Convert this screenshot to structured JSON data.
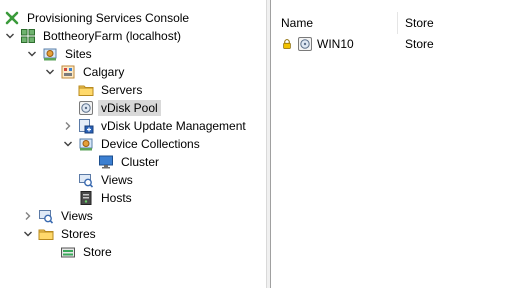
{
  "tree": {
    "root": "Provisioning Services Console",
    "farm": "BottheoryFarm (localhost)",
    "sites": "Sites",
    "site": "Calgary",
    "servers": "Servers",
    "vdisk_pool": "vDisk Pool",
    "vdisk_update": "vDisk Update Management",
    "device_collections": "Device Collections",
    "cluster": "Cluster",
    "site_views": "Views",
    "hosts": "Hosts",
    "views": "Views",
    "stores": "Stores",
    "store": "Store"
  },
  "list": {
    "columns": [
      "Name",
      "Store"
    ],
    "rows": [
      {
        "name": "WIN10",
        "store": "Store",
        "locked": true
      }
    ]
  },
  "colors": {
    "selection": "#d9d9d9",
    "folder": "#f4c95d",
    "lock": "#e0b000"
  }
}
